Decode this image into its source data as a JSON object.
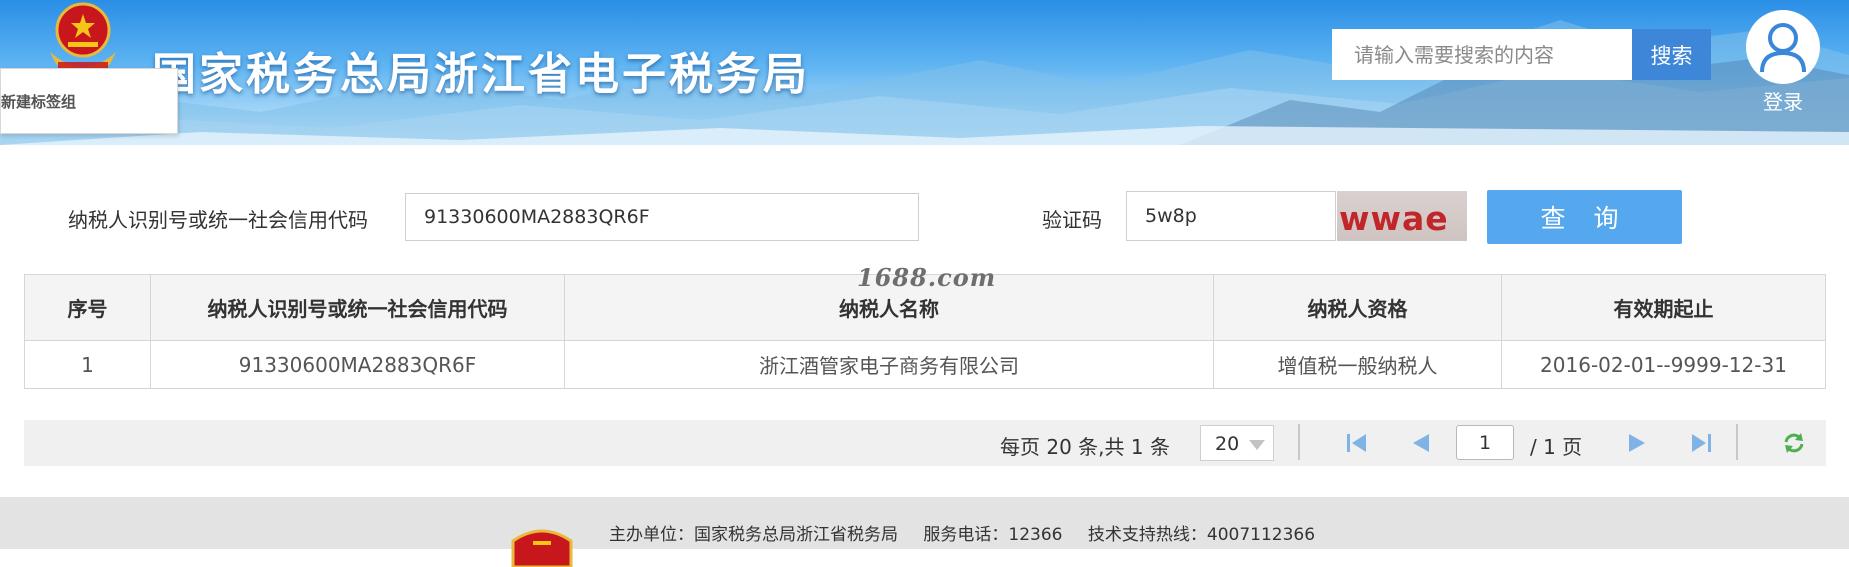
{
  "banner": {
    "title": "国家税务总局浙江省电子税务局",
    "tab_popup_label": "新建标签组",
    "search_placeholder": "请输入需要搜索的内容",
    "search_button": "搜索",
    "login_label": "登录"
  },
  "form": {
    "tax_id_label": "纳税人识别号或统一社会信用代码",
    "tax_id_value": "91330600MA2883QR6F",
    "captcha_label": "验证码",
    "captcha_value": "5w8p",
    "captcha_image_text": "wwae",
    "query_button": "查 询"
  },
  "watermark": "1688.com",
  "table": {
    "headers": [
      "序号",
      "纳税人识别号或统一社会信用代码",
      "纳税人名称",
      "纳税人资格",
      "有效期起止"
    ],
    "rows": [
      [
        "1",
        "91330600MA2883QR6F",
        "浙江酒管家电子商务有限公司",
        "增值税一般纳税人",
        "2016-02-01--9999-12-31"
      ]
    ]
  },
  "pager": {
    "info": "每页 20 条,共 1 条",
    "page_size": "20",
    "current_page": "1",
    "total": "/ 1 页"
  },
  "footer": {
    "host": "主办单位：国家税务总局浙江省税务局",
    "phone": "服务电话：12366",
    "support": "技术支持热线：4007112366"
  },
  "colors": {
    "search_button": "#3d86d8",
    "query_button": "#55a8ee",
    "captcha_text": "#c0262a"
  }
}
